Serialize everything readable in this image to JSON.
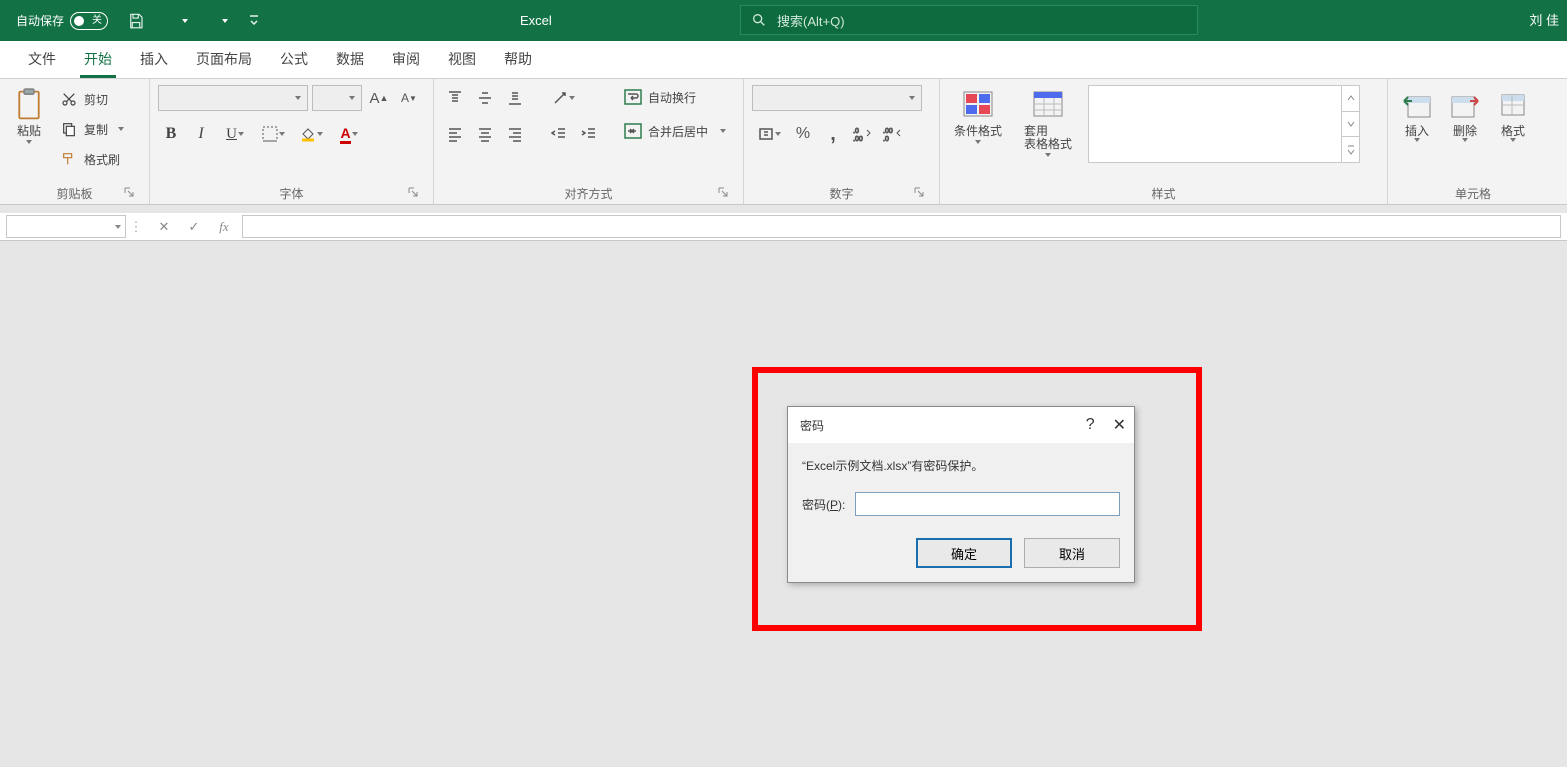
{
  "titlebar": {
    "autosave_label": "自动保存",
    "autosave_state": "关",
    "app_title": "Excel",
    "search_placeholder": "搜索(Alt+Q)",
    "user_name": "刘 佳"
  },
  "tabs": {
    "items": [
      {
        "label": "文件"
      },
      {
        "label": "开始",
        "active": true
      },
      {
        "label": "插入"
      },
      {
        "label": "页面布局"
      },
      {
        "label": "公式"
      },
      {
        "label": "数据"
      },
      {
        "label": "审阅"
      },
      {
        "label": "视图"
      },
      {
        "label": "帮助"
      }
    ]
  },
  "ribbon": {
    "clipboard": {
      "label": "剪贴板",
      "paste": "粘贴",
      "cut": "剪切",
      "copy": "复制",
      "painter": "格式刷"
    },
    "font": {
      "label": "字体",
      "grow": "A",
      "shrink": "A"
    },
    "align": {
      "label": "对齐方式",
      "wrap": "自动换行",
      "merge": "合并后居中"
    },
    "number": {
      "label": "数字"
    },
    "styles": {
      "label": "样式",
      "cond": "条件格式",
      "table": "套用\n表格格式"
    },
    "cells": {
      "label": "单元格",
      "insert": "插入",
      "delete": "删除",
      "format": "格式"
    }
  },
  "dialog": {
    "title": "密码",
    "message": "“Excel示例文档.xlsx”有密码保护。",
    "password_label": "密码(P):",
    "ok": "确定",
    "cancel": "取消"
  }
}
